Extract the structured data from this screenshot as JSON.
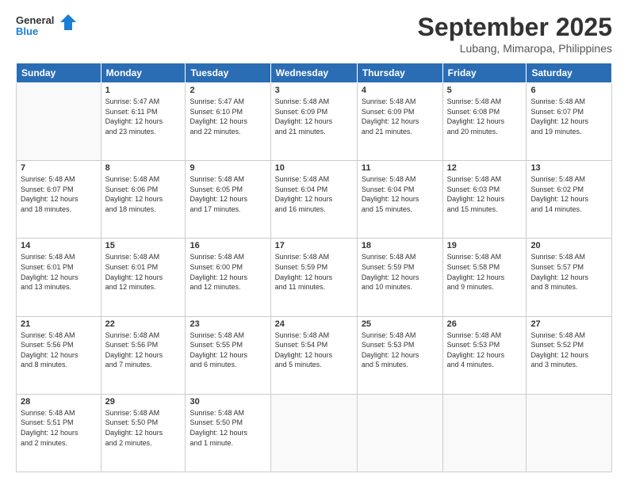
{
  "header": {
    "logo_line1": "General",
    "logo_line2": "Blue",
    "month": "September 2025",
    "location": "Lubang, Mimaropa, Philippines"
  },
  "weekdays": [
    "Sunday",
    "Monday",
    "Tuesday",
    "Wednesday",
    "Thursday",
    "Friday",
    "Saturday"
  ],
  "weeks": [
    [
      {
        "day": "",
        "info": ""
      },
      {
        "day": "1",
        "info": "Sunrise: 5:47 AM\nSunset: 6:11 PM\nDaylight: 12 hours\nand 23 minutes."
      },
      {
        "day": "2",
        "info": "Sunrise: 5:47 AM\nSunset: 6:10 PM\nDaylight: 12 hours\nand 22 minutes."
      },
      {
        "day": "3",
        "info": "Sunrise: 5:48 AM\nSunset: 6:09 PM\nDaylight: 12 hours\nand 21 minutes."
      },
      {
        "day": "4",
        "info": "Sunrise: 5:48 AM\nSunset: 6:09 PM\nDaylight: 12 hours\nand 21 minutes."
      },
      {
        "day": "5",
        "info": "Sunrise: 5:48 AM\nSunset: 6:08 PM\nDaylight: 12 hours\nand 20 minutes."
      },
      {
        "day": "6",
        "info": "Sunrise: 5:48 AM\nSunset: 6:07 PM\nDaylight: 12 hours\nand 19 minutes."
      }
    ],
    [
      {
        "day": "7",
        "info": "Sunrise: 5:48 AM\nSunset: 6:07 PM\nDaylight: 12 hours\nand 18 minutes."
      },
      {
        "day": "8",
        "info": "Sunrise: 5:48 AM\nSunset: 6:06 PM\nDaylight: 12 hours\nand 18 minutes."
      },
      {
        "day": "9",
        "info": "Sunrise: 5:48 AM\nSunset: 6:05 PM\nDaylight: 12 hours\nand 17 minutes."
      },
      {
        "day": "10",
        "info": "Sunrise: 5:48 AM\nSunset: 6:04 PM\nDaylight: 12 hours\nand 16 minutes."
      },
      {
        "day": "11",
        "info": "Sunrise: 5:48 AM\nSunset: 6:04 PM\nDaylight: 12 hours\nand 15 minutes."
      },
      {
        "day": "12",
        "info": "Sunrise: 5:48 AM\nSunset: 6:03 PM\nDaylight: 12 hours\nand 15 minutes."
      },
      {
        "day": "13",
        "info": "Sunrise: 5:48 AM\nSunset: 6:02 PM\nDaylight: 12 hours\nand 14 minutes."
      }
    ],
    [
      {
        "day": "14",
        "info": "Sunrise: 5:48 AM\nSunset: 6:01 PM\nDaylight: 12 hours\nand 13 minutes."
      },
      {
        "day": "15",
        "info": "Sunrise: 5:48 AM\nSunset: 6:01 PM\nDaylight: 12 hours\nand 12 minutes."
      },
      {
        "day": "16",
        "info": "Sunrise: 5:48 AM\nSunset: 6:00 PM\nDaylight: 12 hours\nand 12 minutes."
      },
      {
        "day": "17",
        "info": "Sunrise: 5:48 AM\nSunset: 5:59 PM\nDaylight: 12 hours\nand 11 minutes."
      },
      {
        "day": "18",
        "info": "Sunrise: 5:48 AM\nSunset: 5:59 PM\nDaylight: 12 hours\nand 10 minutes."
      },
      {
        "day": "19",
        "info": "Sunrise: 5:48 AM\nSunset: 5:58 PM\nDaylight: 12 hours\nand 9 minutes."
      },
      {
        "day": "20",
        "info": "Sunrise: 5:48 AM\nSunset: 5:57 PM\nDaylight: 12 hours\nand 8 minutes."
      }
    ],
    [
      {
        "day": "21",
        "info": "Sunrise: 5:48 AM\nSunset: 5:56 PM\nDaylight: 12 hours\nand 8 minutes."
      },
      {
        "day": "22",
        "info": "Sunrise: 5:48 AM\nSunset: 5:56 PM\nDaylight: 12 hours\nand 7 minutes."
      },
      {
        "day": "23",
        "info": "Sunrise: 5:48 AM\nSunset: 5:55 PM\nDaylight: 12 hours\nand 6 minutes."
      },
      {
        "day": "24",
        "info": "Sunrise: 5:48 AM\nSunset: 5:54 PM\nDaylight: 12 hours\nand 5 minutes."
      },
      {
        "day": "25",
        "info": "Sunrise: 5:48 AM\nSunset: 5:53 PM\nDaylight: 12 hours\nand 5 minutes."
      },
      {
        "day": "26",
        "info": "Sunrise: 5:48 AM\nSunset: 5:53 PM\nDaylight: 12 hours\nand 4 minutes."
      },
      {
        "day": "27",
        "info": "Sunrise: 5:48 AM\nSunset: 5:52 PM\nDaylight: 12 hours\nand 3 minutes."
      }
    ],
    [
      {
        "day": "28",
        "info": "Sunrise: 5:48 AM\nSunset: 5:51 PM\nDaylight: 12 hours\nand 2 minutes."
      },
      {
        "day": "29",
        "info": "Sunrise: 5:48 AM\nSunset: 5:50 PM\nDaylight: 12 hours\nand 2 minutes."
      },
      {
        "day": "30",
        "info": "Sunrise: 5:48 AM\nSunset: 5:50 PM\nDaylight: 12 hours\nand 1 minute."
      },
      {
        "day": "",
        "info": ""
      },
      {
        "day": "",
        "info": ""
      },
      {
        "day": "",
        "info": ""
      },
      {
        "day": "",
        "info": ""
      }
    ]
  ]
}
